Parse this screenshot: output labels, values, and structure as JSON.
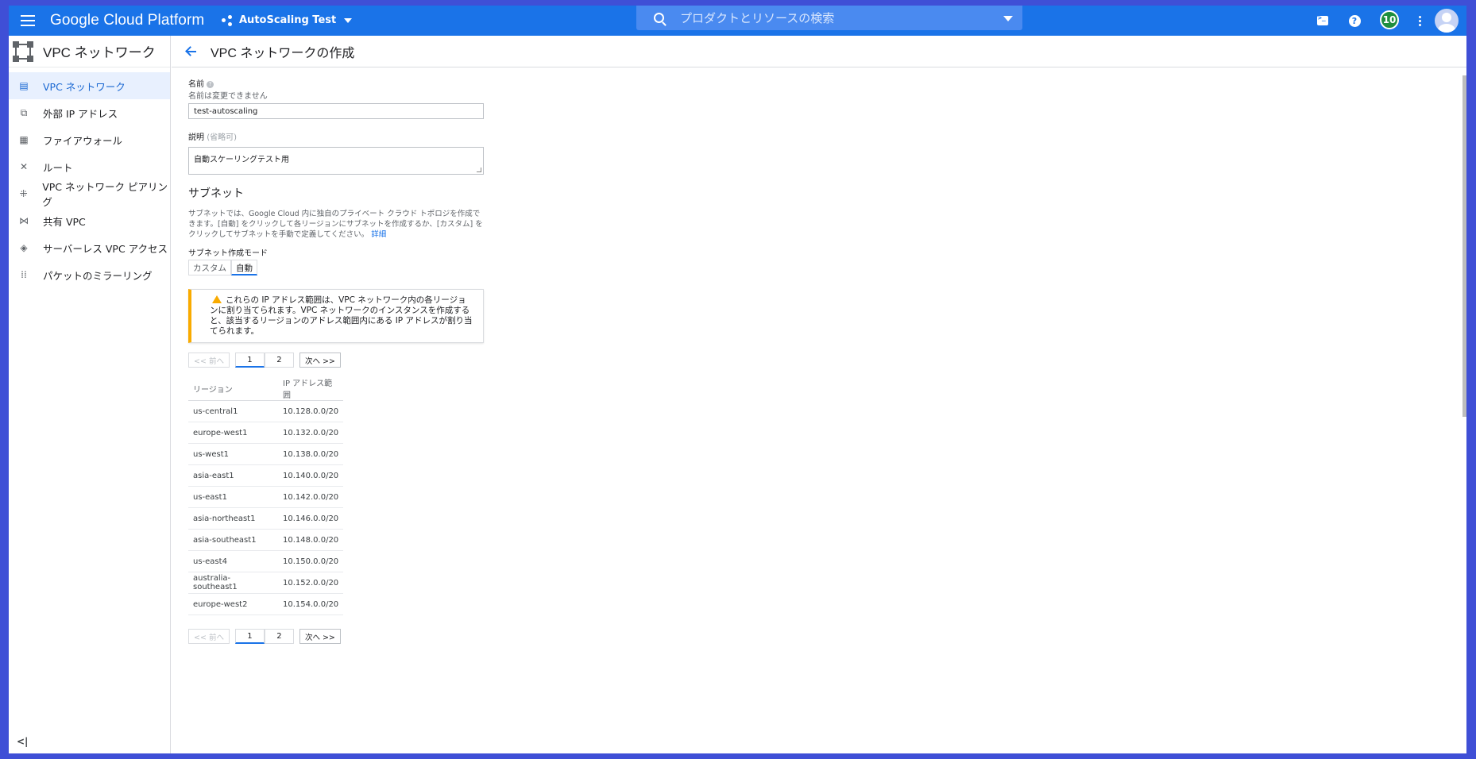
{
  "topbar": {
    "brand": "Google Cloud Platform",
    "project": "AutoScaling Test",
    "search_placeholder": "プロダクトとリソースの検索",
    "notification_count": "10",
    "accent_color": "#1a73e8"
  },
  "sidebar": {
    "title": "VPC ネットワーク",
    "items": [
      {
        "label": "VPC ネットワーク",
        "icon": "vpc-network-icon",
        "active": true
      },
      {
        "label": "外部 IP アドレス",
        "icon": "external-ip-icon",
        "active": false
      },
      {
        "label": "ファイアウォール",
        "icon": "firewall-icon",
        "active": false
      },
      {
        "label": "ルート",
        "icon": "routes-icon",
        "active": false
      },
      {
        "label": "VPC ネットワーク ピアリング",
        "icon": "peering-icon",
        "active": false
      },
      {
        "label": "共有 VPC",
        "icon": "shared-vpc-icon",
        "active": false
      },
      {
        "label": "サーバーレス VPC アクセス",
        "icon": "serverless-icon",
        "active": false
      },
      {
        "label": "パケットのミラーリング",
        "icon": "packet-mirroring-icon",
        "active": false
      }
    ],
    "collapse_label": "<|"
  },
  "page": {
    "title": "VPC ネットワークの作成"
  },
  "form": {
    "name_label": "名前",
    "name_help": "?",
    "name_sublabel": "名前は変更できません",
    "name_value": "test-autoscaling",
    "desc_label": "説明",
    "desc_optional": "(省略可)",
    "desc_value": "自動スケーリングテスト用",
    "subnet_heading": "サブネット",
    "subnet_desc": "サブネットでは、Google Cloud 内に独自のプライベート クラウド トポロジを作成できます。[自動] をクリックして各リージョンにサブネットを作成するか、[カスタム] をクリックしてサブネットを手動で定義してください。",
    "subnet_desc_link": "詳細",
    "mode_label": "サブネット作成モード",
    "mode_custom": "カスタム",
    "mode_auto": "自動",
    "alert_text": "これらの IP アドレス範囲は、VPC ネットワーク内の各リージョンに割り当てられます。VPC ネットワークのインスタンスを作成すると、該当するリージョンのアドレス範囲内にある IP アドレスが割り当てられます。"
  },
  "pager": {
    "prev": "<< 前へ",
    "page1": "1",
    "page2": "2",
    "next": "次へ >>"
  },
  "table": {
    "headers": [
      "リージョン",
      "IP アドレス範囲"
    ],
    "rows": [
      [
        "us-central1",
        "10.128.0.0/20"
      ],
      [
        "europe-west1",
        "10.132.0.0/20"
      ],
      [
        "us-west1",
        "10.138.0.0/20"
      ],
      [
        "asia-east1",
        "10.140.0.0/20"
      ],
      [
        "us-east1",
        "10.142.0.0/20"
      ],
      [
        "asia-northeast1",
        "10.146.0.0/20"
      ],
      [
        "asia-southeast1",
        "10.148.0.0/20"
      ],
      [
        "us-east4",
        "10.150.0.0/20"
      ],
      [
        "australia-southeast1",
        "10.152.0.0/20"
      ],
      [
        "europe-west2",
        "10.154.0.0/20"
      ]
    ]
  }
}
